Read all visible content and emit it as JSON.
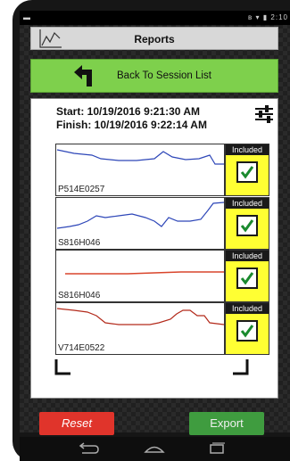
{
  "status_bar": {
    "right_text": "2:10"
  },
  "header": {
    "title": "Reports",
    "icon": "chart-line-icon"
  },
  "back_button": {
    "label": "Back To Session List",
    "icon": "back-arrow-icon"
  },
  "session": {
    "start_text": "Start: 10/19/2016 9:21:30 AM",
    "finish_text": "Finish: 10/19/2016 9:22:14 AM",
    "filter_icon": "sliders-icon"
  },
  "sensors": [
    {
      "id": "P514E0257",
      "included_label": "Included",
      "included": true,
      "color": "#2d46b8"
    },
    {
      "id": "S816H046",
      "included_label": "Included",
      "included": true,
      "color": "#2d46b8"
    },
    {
      "id": "S816H046",
      "included_label": "Included",
      "included": true,
      "color": "#d9452b"
    },
    {
      "id": "V714E0522",
      "included_label": "Included",
      "included": true,
      "color": "#b32a1b"
    }
  ],
  "footer": {
    "reset_label": "Reset",
    "export_label": "Export"
  },
  "colors": {
    "accent_green": "#7ed04c",
    "reset_red": "#e0342b",
    "export_green": "#3f9c3f",
    "include_yellow": "#ffff33"
  }
}
